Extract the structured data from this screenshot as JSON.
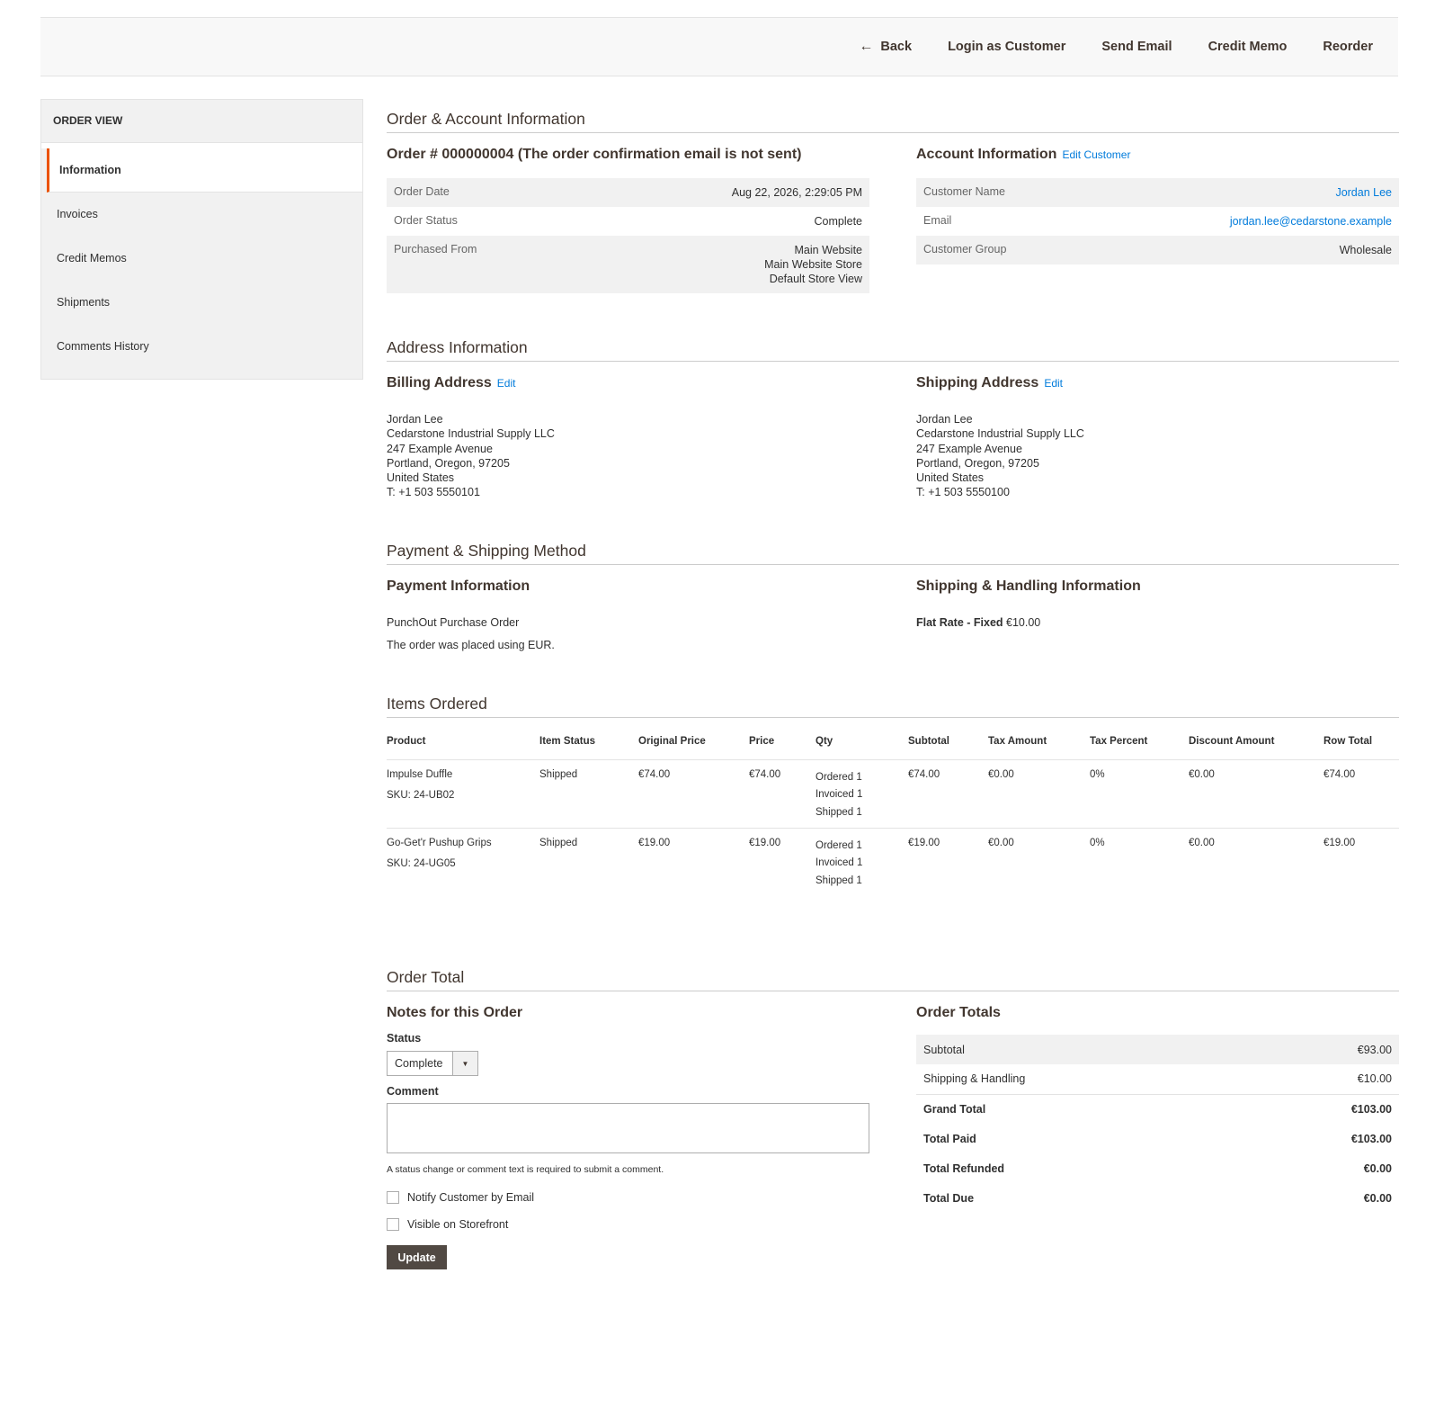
{
  "actions": {
    "back": "Back",
    "login_as_customer": "Login as Customer",
    "send_email": "Send Email",
    "credit_memo": "Credit Memo",
    "reorder": "Reorder"
  },
  "sidebar": {
    "title": "Order View",
    "items": [
      {
        "label": "Information"
      },
      {
        "label": "Invoices"
      },
      {
        "label": "Credit Memos"
      },
      {
        "label": "Shipments"
      },
      {
        "label": "Comments History"
      }
    ]
  },
  "order_account": {
    "section_title": "Order & Account Information",
    "order_heading": "Order # 000000004 (The order confirmation email is not sent)",
    "order_date_label": "Order Date",
    "order_date": "Aug 22, 2026, 2:29:05 PM",
    "order_status_label": "Order Status",
    "order_status": "Complete",
    "purchased_from_label": "Purchased From",
    "purchased_from": [
      "Main Website",
      "Main Website Store",
      "Default Store View"
    ],
    "account_heading": "Account Information",
    "edit_customer": "Edit Customer",
    "customer_name_label": "Customer Name",
    "customer_name": "Jordan Lee",
    "email_label": "Email",
    "email": "jordan.lee@cedarstone.example",
    "customer_group_label": "Customer Group",
    "customer_group": "Wholesale"
  },
  "address": {
    "section_title": "Address Information",
    "billing_heading": "Billing Address",
    "shipping_heading": "Shipping Address",
    "edit": "Edit",
    "billing_lines": [
      "Jordan Lee",
      "Cedarstone Industrial Supply LLC",
      "247 Example Avenue",
      "Portland, Oregon, 97205",
      "United States",
      "T: +1 503 5550101"
    ],
    "shipping_lines": [
      "Jordan Lee",
      "Cedarstone Industrial Supply LLC",
      "247 Example Avenue",
      "Portland, Oregon, 97205",
      "United States",
      "T: +1 503 5550100"
    ]
  },
  "payment": {
    "section_title": "Payment & Shipping Method",
    "payment_heading": "Payment Information",
    "payment_method": "PunchOut Purchase Order",
    "currency_note": "The order was placed using EUR.",
    "shipping_heading": "Shipping & Handling Information",
    "shipping_method": "Flat Rate - Fixed",
    "shipping_price": "€10.00"
  },
  "items": {
    "section_title": "Items Ordered",
    "columns": [
      "Product",
      "Item Status",
      "Original Price",
      "Price",
      "Qty",
      "Subtotal",
      "Tax Amount",
      "Tax Percent",
      "Discount Amount",
      "Row Total"
    ],
    "rows": [
      {
        "product": "Impulse Duffle",
        "sku": "SKU: 24-UB02",
        "status": "Shipped",
        "original_price": "€74.00",
        "price": "€74.00",
        "qty": [
          "Ordered 1",
          "Invoiced 1",
          "Shipped 1"
        ],
        "subtotal": "€74.00",
        "tax_amount": "€0.00",
        "tax_percent": "0%",
        "discount": "€0.00",
        "row_total": "€74.00"
      },
      {
        "product": "Go-Get'r Pushup Grips",
        "sku": "SKU: 24-UG05",
        "status": "Shipped",
        "original_price": "€19.00",
        "price": "€19.00",
        "qty": [
          "Ordered 1",
          "Invoiced 1",
          "Shipped 1"
        ],
        "subtotal": "€19.00",
        "tax_amount": "€0.00",
        "tax_percent": "0%",
        "discount": "€0.00",
        "row_total": "€19.00"
      }
    ]
  },
  "order_total": {
    "section_title": "Order Total",
    "notes_heading": "Notes for this Order",
    "status_label": "Status",
    "status_value": "Complete",
    "comment_label": "Comment",
    "comment_value": "",
    "comment_note": "A status change or comment text is required to submit a comment.",
    "notify_label": "Notify Customer by Email",
    "visible_label": "Visible on Storefront",
    "update_button": "Update",
    "totals_heading": "Order Totals",
    "totals": [
      {
        "label": "Subtotal",
        "amount": "€93.00"
      },
      {
        "label": "Shipping & Handling",
        "amount": "€10.00"
      },
      {
        "label": "Grand Total",
        "amount": "€103.00"
      },
      {
        "label": "Total Paid",
        "amount": "€103.00"
      },
      {
        "label": "Total Refunded",
        "amount": "€0.00"
      },
      {
        "label": "Total Due",
        "amount": "€0.00"
      }
    ]
  }
}
